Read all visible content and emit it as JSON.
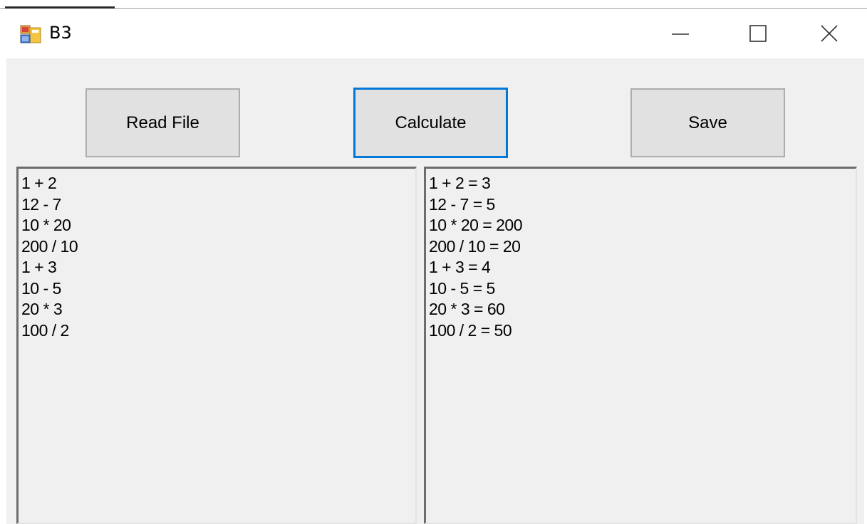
{
  "window": {
    "title": "B3",
    "app_icon": "winforms-app-icon",
    "controls": {
      "minimize_icon": "minimize-icon",
      "maximize_icon": "maximize-icon",
      "close_icon": "close-icon"
    }
  },
  "toolbar": {
    "read_file_label": "Read File",
    "calculate_label": "Calculate",
    "save_label": "Save",
    "focused_button": "Calculate"
  },
  "input_box": {
    "lines": [
      "1 + 2",
      "12 - 7",
      "10 * 20",
      "200 / 10",
      "1 + 3",
      "10 - 5",
      "20 * 3",
      "100 / 2"
    ]
  },
  "output_box": {
    "lines": [
      "1 + 2 = 3",
      "12 - 7 = 5",
      "10 * 20 = 200",
      "200 / 10 = 20",
      "1 + 3 = 4",
      "10 - 5 = 5",
      "20 * 3 = 60",
      "100 / 2 = 50"
    ]
  },
  "colors": {
    "focus_border": "#0078d7",
    "button_face": "#e1e1e1",
    "client_bg": "#f0f0f0"
  }
}
